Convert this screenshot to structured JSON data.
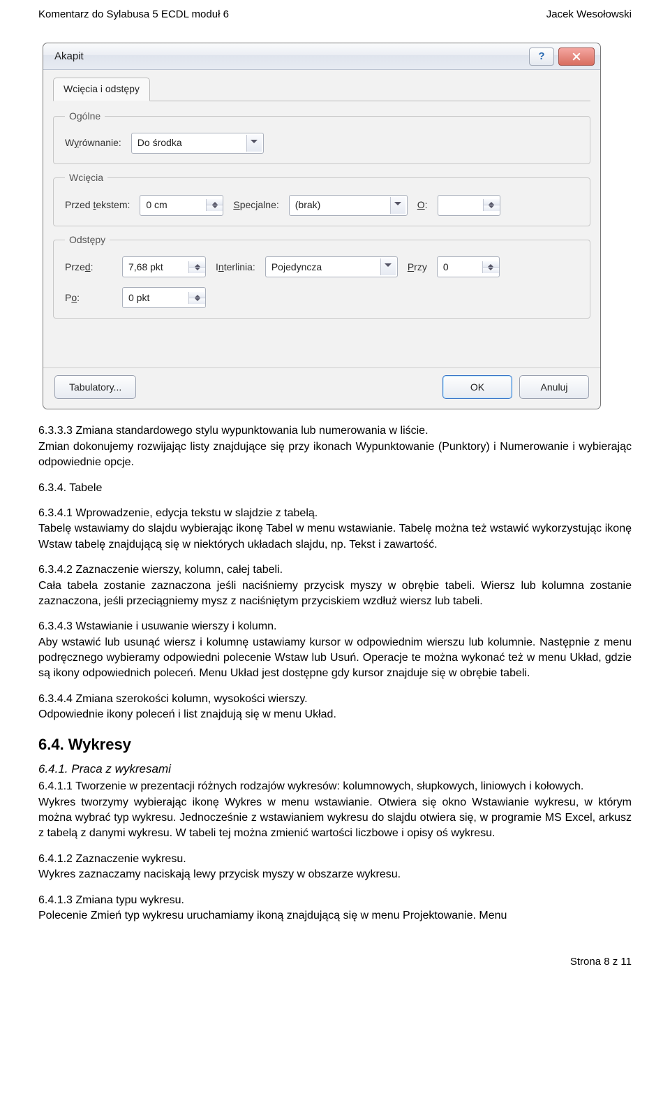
{
  "header": {
    "left": "Komentarz do Sylabusa 5 ECDL moduł 6",
    "right": "Jacek Wesołowski"
  },
  "dialog": {
    "title": "Akapit",
    "tab_label": "Wcięcia i odstępy",
    "groups": {
      "general": {
        "legend": "Ogólne",
        "align_label": "Wyrównanie:",
        "align_value": "Do środka"
      },
      "indent": {
        "legend": "Wcięcia",
        "before_text_label": "Przed tekstem:",
        "before_text_value": "0 cm",
        "special_label": "Specjalne:",
        "special_value": "(brak)",
        "o_label": "O:",
        "o_value": ""
      },
      "spacing": {
        "legend": "Odstępy",
        "before_label": "Przed:",
        "before_value": "7,68 pkt",
        "interline_label": "Interlinia:",
        "interline_value": "Pojedyncza",
        "at_label": "Przy",
        "at_value": "0",
        "after_label": "Po:",
        "after_value": "0 pkt"
      }
    },
    "buttons": {
      "tabs": "Tabulatory...",
      "ok": "OK",
      "cancel": "Anuluj"
    }
  },
  "body": {
    "p1_title": "6.3.3.3 Zmiana standardowego stylu wypunktowania lub numerowania w liście.",
    "p1_text": "Zmian dokonujemy rozwijając listy znajdujące się przy ikonach Wypunktowanie (Punktory) i Numerowanie i wybierając odpowiednie opcje.",
    "p2_title": "6.3.4. Tabele",
    "p3_title": "6.3.4.1 Wprowadzenie, edycja tekstu w slajdzie z tabelą.",
    "p3_text": "Tabelę wstawiamy do slajdu wybierając ikonę Tabel w menu wstawianie. Tabelę można też wstawić wykorzystując ikonę Wstaw tabelę znajdującą się w niektórych układach slajdu, np. Tekst i zawartość.",
    "p4_title": "6.3.4.2 Zaznaczenie wierszy, kolumn, całej tabeli.",
    "p4_text": "Cała tabela zostanie zaznaczona jeśli naciśniemy przycisk myszy w obrębie tabeli. Wiersz lub kolumna zostanie zaznaczona, jeśli przeciągniemy mysz z naciśniętym przyciskiem wzdłuż wiersz lub tabeli.",
    "p5_title": "6.3.4.3 Wstawianie i usuwanie wierszy i kolumn.",
    "p5_text": "Aby wstawić lub usunąć wiersz i kolumnę ustawiamy kursor w odpowiednim wierszu lub kolumnie. Następnie z menu podręcznego wybieramy odpowiedni polecenie Wstaw lub Usuń. Operacje te można wykonać też w menu Układ, gdzie są ikony odpowiednich poleceń. Menu Układ jest dostępne gdy kursor znajduje się w obrębie tabeli.",
    "p6_title": "6.3.4.4 Zmiana szerokości kolumn, wysokości wierszy.",
    "p6_text": "Odpowiednie ikony poleceń i list znajdują się w menu Układ.",
    "h64": "6.4. Wykresy",
    "h641": "6.4.1. Praca z wykresami",
    "p7_title": "6.4.1.1 Tworzenie w prezentacji różnych rodzajów wykresów: kolumnowych, słupkowych, liniowych i kołowych.",
    "p7_text": "Wykres tworzymy wybierając ikonę Wykres w menu wstawianie. Otwiera się okno Wstawianie wykresu, w którym można wybrać typ wykresu. Jednocześnie z wstawianiem wykresu do slajdu otwiera się, w programie MS Excel, arkusz z tabelą z danymi wykresu. W tabeli tej można zmienić wartości liczbowe i opisy oś wykresu.",
    "p8_title": "6.4.1.2 Zaznaczenie wykresu.",
    "p8_text": "Wykres zaznaczamy naciskają lewy przycisk myszy w obszarze wykresu.",
    "p9_title": "6.4.1.3 Zmiana typu wykresu.",
    "p9_text": "Polecenie Zmień typ wykresu uruchamiamy ikoną znajdującą się w menu Projektowanie. Menu"
  },
  "footer": "Strona 8 z 11"
}
